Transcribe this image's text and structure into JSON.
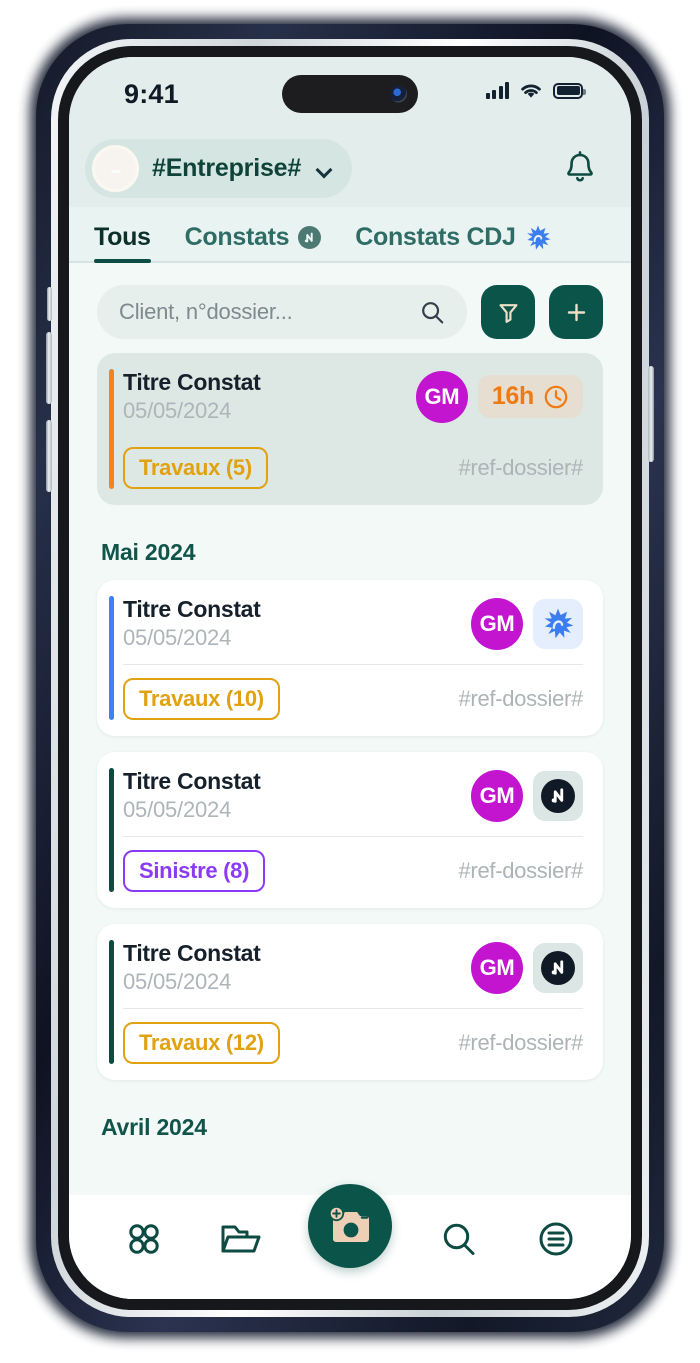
{
  "status_bar": {
    "time": "9:41",
    "signal_icon": "cellular-signal-icon",
    "wifi_icon": "wifi-icon",
    "battery_icon": "battery-full-icon"
  },
  "header": {
    "avatar_name": "user-avatar",
    "org_name": "#Entreprise#",
    "chevron_icon": "chevron-down-icon",
    "notification_icon": "bell-icon"
  },
  "tabs": [
    {
      "label": "Tous",
      "active": true,
      "icon": null
    },
    {
      "label": "Constats",
      "active": false,
      "icon": "n-badge-icon"
    },
    {
      "label": "Constats CDJ",
      "active": false,
      "icon": "cdj-starburst-icon"
    }
  ],
  "toolbar": {
    "search_placeholder": "Client, n°dossier...",
    "search_value": "",
    "search_icon": "search-icon",
    "filter_icon": "filter-funnel-icon",
    "add_icon": "plus-icon"
  },
  "pinned_card": {
    "title": "Titre Constat",
    "date": "05/05/2024",
    "initials": "GM",
    "time_badge": "16h",
    "clock_icon": "clock-icon",
    "tag": "Travaux (5)",
    "tag_type": "travaux",
    "reference": "#ref-dossier#",
    "accent_color": "#f5821f"
  },
  "groups": [
    {
      "title": "Mai 2024",
      "cards": [
        {
          "title": "Titre Constat",
          "date": "05/05/2024",
          "initials": "GM",
          "tile_icon": "cdj-starburst-icon",
          "tag": "Travaux (10)",
          "tag_type": "travaux",
          "reference": "#ref-dossier#",
          "accent_color": "#3b82f6"
        },
        {
          "title": "Titre Constat",
          "date": "05/05/2024",
          "initials": "GM",
          "tile_icon": "n-badge-icon",
          "tag": "Sinistre (8)",
          "tag_type": "sinistre",
          "reference": "#ref-dossier#",
          "accent_color": "#0e4a40"
        },
        {
          "title": "Titre Constat",
          "date": "05/05/2024",
          "initials": "GM",
          "tile_icon": "n-badge-icon",
          "tag": "Travaux (12)",
          "tag_type": "travaux",
          "reference": "#ref-dossier#",
          "accent_color": "#0e4a40"
        }
      ]
    },
    {
      "title": "Avril 2024",
      "cards": []
    }
  ],
  "bottom_nav": [
    {
      "name": "dashboard-grid-icon"
    },
    {
      "name": "folder-icon"
    },
    {
      "name": "camera-capture-icon"
    },
    {
      "name": "search-icon"
    },
    {
      "name": "menu-list-icon"
    }
  ],
  "colors": {
    "brand_dark_green": "#0b5449",
    "accent_orange": "#f07a12",
    "accent_purple": "#c314cf",
    "tag_yellow": "#e0a211",
    "tag_purple": "#8b3af5",
    "screen_bg": "#f2f9f7",
    "header_bg": "#e3eeec"
  }
}
